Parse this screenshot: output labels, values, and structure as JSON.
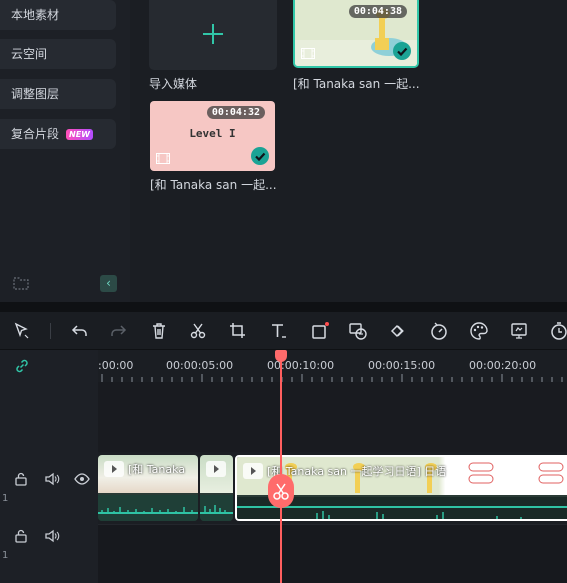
{
  "sidebar": {
    "items": [
      {
        "label": "本地素材"
      },
      {
        "label": "云空间"
      },
      {
        "label": "调整图层"
      },
      {
        "label": "复合片段",
        "badge": "NEW"
      }
    ],
    "folder_icon": "folder-add-icon",
    "collapse_icon": "chevron-left-icon"
  },
  "media": {
    "import_label": "导入媒体",
    "clips": [
      {
        "caption": "[和 Tanaka san 一起...",
        "duration": "00:04:38",
        "selected": true
      },
      {
        "caption": "[和 Tanaka san 一起...",
        "duration": "00:04:32",
        "thumb_text": "Level I",
        "selected": true
      }
    ]
  },
  "toolbar": {
    "tools": [
      "select-icon",
      "undo-icon",
      "redo-icon",
      "delete-icon",
      "cut-icon",
      "crop-icon",
      "text-icon",
      "shape-icon",
      "ai-icon",
      "keyframe-icon",
      "speed-icon",
      "color-icon",
      "export-frame-icon",
      "timer-icon"
    ]
  },
  "timeline": {
    "timecodes": [
      ":00:00",
      "00:00:05:00",
      "00:00:10:00",
      "00:00:15:00",
      "00:00:20:00"
    ],
    "tracks": [
      {
        "number": "1"
      },
      {
        "number": "1"
      }
    ],
    "clips": [
      {
        "label": "[和 Tanaka"
      },
      {
        "label": ""
      },
      {
        "label": "[和 Tanaka san 一起学习日语] 日语"
      }
    ]
  },
  "colors": {
    "accent": "#31c6a8",
    "playhead": "#ff5f5f",
    "badge_start": "#ff4fb8",
    "badge_end": "#b24dff"
  }
}
